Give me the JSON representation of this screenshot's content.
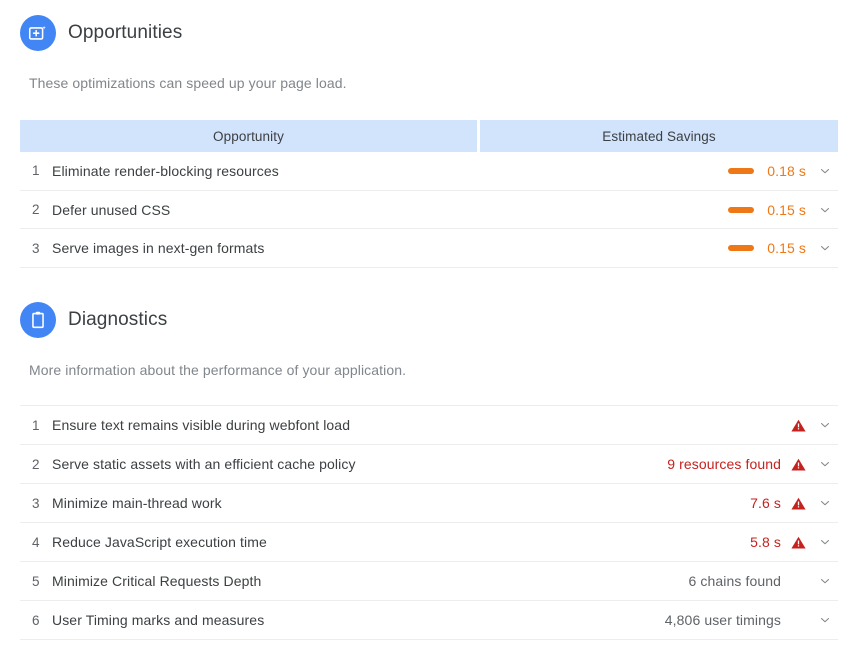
{
  "opportunities": {
    "title": "Opportunities",
    "icon": "opportunity-spark-icon",
    "description": "These optimizations can speed up your page load.",
    "columns": {
      "name": "Opportunity",
      "savings": "Estimated Savings"
    },
    "rows": [
      {
        "index": "1",
        "label": "Eliminate render-blocking resources",
        "savings": "0.18 s",
        "bar_color": "#ef7816"
      },
      {
        "index": "2",
        "label": "Defer unused CSS",
        "savings": "0.15 s",
        "bar_color": "#ef7816"
      },
      {
        "index": "3",
        "label": "Serve images in next-gen formats",
        "savings": "0.15 s",
        "bar_color": "#ef7816"
      }
    ]
  },
  "diagnostics": {
    "title": "Diagnostics",
    "icon": "clipboard-icon",
    "description": "More information about the performance of your application.",
    "rows": [
      {
        "index": "1",
        "label": "Ensure text remains visible during webfont load",
        "value": "",
        "severity": "fail"
      },
      {
        "index": "2",
        "label": "Serve static assets with an efficient cache policy",
        "value": "9 resources found",
        "severity": "fail"
      },
      {
        "index": "3",
        "label": "Minimize main-thread work",
        "value": "7.6 s",
        "severity": "fail"
      },
      {
        "index": "4",
        "label": "Reduce JavaScript execution time",
        "value": "5.8 s",
        "severity": "fail"
      },
      {
        "index": "5",
        "label": "Minimize Critical Requests Depth",
        "value": "6 chains found",
        "severity": "neutral"
      },
      {
        "index": "6",
        "label": "User Timing marks and measures",
        "value": "4,806 user timings",
        "severity": "neutral"
      }
    ]
  },
  "colors": {
    "accent_blue": "#4285f4",
    "header_bg": "#d2e3fc",
    "orange": "#ef7816",
    "fail_red": "#c5221f",
    "neutral_gray": "#5f6368"
  }
}
